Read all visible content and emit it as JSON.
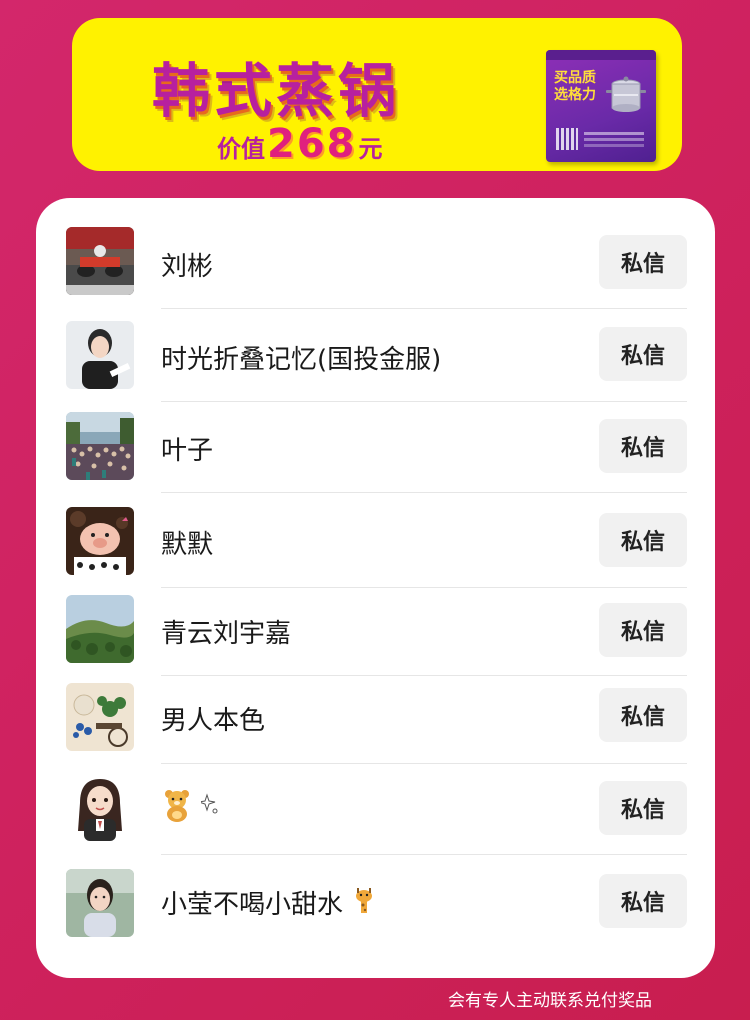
{
  "banner": {
    "title": "韩式蒸锅",
    "value_prefix": "价值",
    "value_amount": "268",
    "value_unit": "元",
    "product_label": "买品质选格力",
    "colors": {
      "background": "#fff200",
      "title": "#b7209f",
      "accent": "#e0207e"
    }
  },
  "list": {
    "items": [
      {
        "name": "刘彬",
        "action": "私信",
        "avatar": "kart-racing-photo"
      },
      {
        "name": "时光折叠记忆(国投金服)",
        "action": "私信",
        "avatar": "woman-portrait"
      },
      {
        "name": "叶子",
        "action": "私信",
        "avatar": "crowd-photo"
      },
      {
        "name": "默默",
        "action": "私信",
        "avatar": "pig-toy-photo"
      },
      {
        "name": "青云刘宇嘉",
        "action": "私信",
        "avatar": "forest-hill-photo"
      },
      {
        "name": "男人本色",
        "action": "私信",
        "avatar": "flower-cart-photo"
      },
      {
        "name": "",
        "action": "私信",
        "avatar": "cartoon-girl-illustration",
        "name_icons": [
          "teddy-bear-emoji",
          "sparkle-emoji"
        ]
      },
      {
        "name": "小莹不喝小甜水",
        "action": "私信",
        "avatar": "woman-outdoor-photo",
        "name_icons": [
          "giraffe-emoji"
        ]
      }
    ]
  },
  "footer": {
    "note": "会有专人主动联系兑付奖品"
  },
  "colors": {
    "page_background": "#cf225f",
    "card_background": "#ffffff",
    "button_background": "#f1f1f1"
  }
}
